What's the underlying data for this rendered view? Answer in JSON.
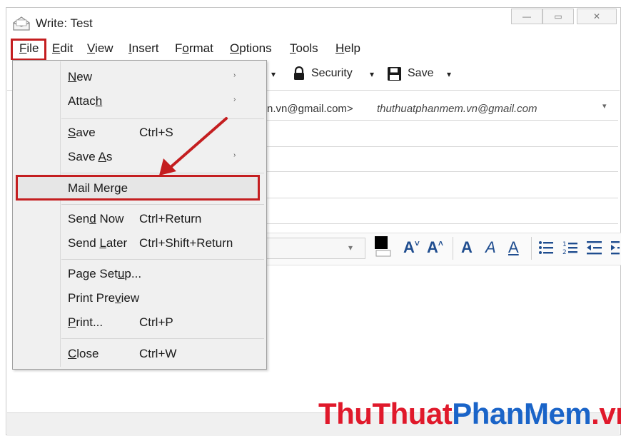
{
  "window": {
    "title": "Write: Test",
    "minimize_glyph": "—",
    "restore_glyph": "▭",
    "close_glyph": "✕"
  },
  "menubar": {
    "items": [
      {
        "label": "File",
        "mnemonic": "F",
        "rest": "ile"
      },
      {
        "label": "Edit",
        "mnemonic": "E",
        "rest": "dit"
      },
      {
        "label": "View",
        "mnemonic": "V",
        "rest": "iew"
      },
      {
        "label": "Insert",
        "mnemonic": "I",
        "rest": "nsert"
      },
      {
        "label": "Format",
        "pre": "F",
        "mnemonic": "o",
        "rest": "rmat"
      },
      {
        "label": "Options",
        "mnemonic": "O",
        "rest": "ptions"
      },
      {
        "label": "Tools",
        "mnemonic": "T",
        "rest": "ools"
      },
      {
        "label": "Help",
        "mnemonic": "H",
        "rest": "elp"
      }
    ]
  },
  "toolbar": {
    "security_label": "Security",
    "save_label": "Save",
    "dropdown_glyph": "▾"
  },
  "compose": {
    "from_partial": "n.vn@gmail.com>",
    "from_italic": "thuthuatphanmem.vn@gmail.com",
    "from_dropdown": "▾"
  },
  "format_toolbar": {
    "font_dropdown": "▾",
    "buttons": [
      "A˅",
      "A˄",
      "A",
      "A",
      "A",
      "☰",
      "☷",
      "⇤",
      "⇥"
    ]
  },
  "file_menu": {
    "items": [
      {
        "pre": "",
        "mnemonic": "N",
        "rest": "ew",
        "shortcut": "",
        "submenu": "›"
      },
      {
        "pre": "Attac",
        "mnemonic": "h",
        "rest": "",
        "shortcut": "",
        "submenu": "›"
      },
      {
        "pre": "",
        "mnemonic": "S",
        "rest": "ave",
        "shortcut": "Ctrl+S",
        "submenu": ""
      },
      {
        "pre": "Save ",
        "mnemonic": "A",
        "rest": "s",
        "shortcut": "",
        "submenu": "›"
      },
      {
        "pre": "Mail Merge",
        "mnemonic": "",
        "rest": "",
        "shortcut": "",
        "submenu": ""
      },
      {
        "pre": "Sen",
        "mnemonic": "d",
        "rest": " Now",
        "shortcut": "Ctrl+Return",
        "submenu": ""
      },
      {
        "pre": "Send ",
        "mnemonic": "L",
        "rest": "ater",
        "shortcut": "Ctrl+Shift+Return",
        "submenu": ""
      },
      {
        "pre": "Page Set",
        "mnemonic": "u",
        "rest": "p...",
        "shortcut": "",
        "submenu": ""
      },
      {
        "pre": "Print Pre",
        "mnemonic": "v",
        "rest": "iew",
        "shortcut": "",
        "submenu": ""
      },
      {
        "pre": "",
        "mnemonic": "P",
        "rest": "rint...",
        "shortcut": "Ctrl+P",
        "submenu": ""
      },
      {
        "pre": "",
        "mnemonic": "C",
        "rest": "lose",
        "shortcut": "Ctrl+W",
        "submenu": ""
      }
    ]
  },
  "watermark": {
    "part1": "ThuThuat",
    "part2": "PhanMem",
    "part3": ".vn"
  },
  "colors": {
    "highlight_red": "#c41e20",
    "watermark_red": "#e0192b",
    "watermark_blue": "#1a64c8",
    "format_icon_blue": "#1f4d8f"
  }
}
